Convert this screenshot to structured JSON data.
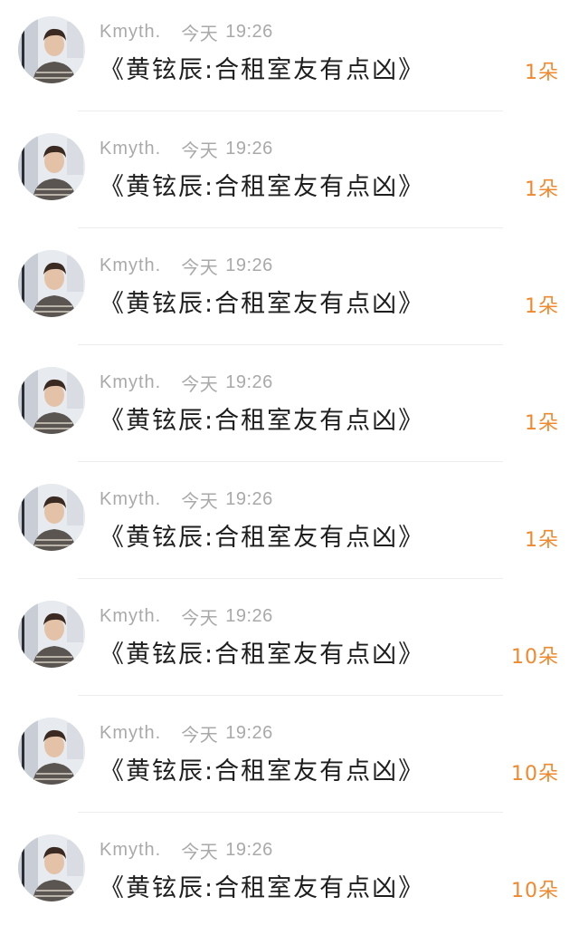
{
  "items": [
    {
      "name": "Kmyth.",
      "day": "今天",
      "time": "19:26",
      "title": "《黄铉辰:合租室友有点凶》",
      "count": "1朵"
    },
    {
      "name": "Kmyth.",
      "day": "今天",
      "time": "19:26",
      "title": "《黄铉辰:合租室友有点凶》",
      "count": "1朵"
    },
    {
      "name": "Kmyth.",
      "day": "今天",
      "time": "19:26",
      "title": "《黄铉辰:合租室友有点凶》",
      "count": "1朵"
    },
    {
      "name": "Kmyth.",
      "day": "今天",
      "time": "19:26",
      "title": "《黄铉辰:合租室友有点凶》",
      "count": "1朵"
    },
    {
      "name": "Kmyth.",
      "day": "今天",
      "time": "19:26",
      "title": "《黄铉辰:合租室友有点凶》",
      "count": "1朵"
    },
    {
      "name": "Kmyth.",
      "day": "今天",
      "time": "19:26",
      "title": "《黄铉辰:合租室友有点凶》",
      "count": "10朵"
    },
    {
      "name": "Kmyth.",
      "day": "今天",
      "time": "19:26",
      "title": "《黄铉辰:合租室友有点凶》",
      "count": "10朵"
    },
    {
      "name": "Kmyth.",
      "day": "今天",
      "time": "19:26",
      "title": "《黄铉辰:合租室友有点凶》",
      "count": "10朵"
    }
  ],
  "colors": {
    "count": "#f0892e",
    "meta": "#a9a9a9",
    "title": "#1e1e1e"
  },
  "icons": {
    "avatar": "user-avatar-photo"
  }
}
